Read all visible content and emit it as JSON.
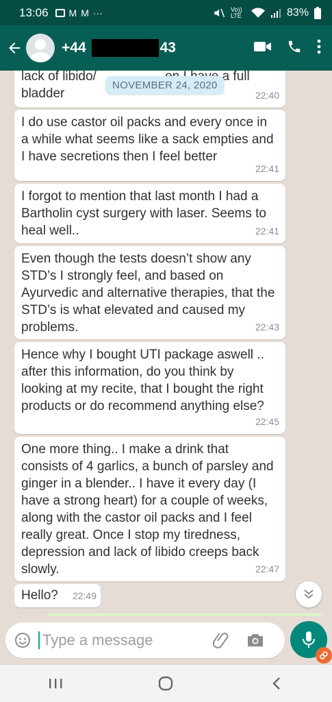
{
  "status_bar": {
    "time": "13:06",
    "network_label": "Vo)) LTE",
    "battery": "83%"
  },
  "header": {
    "contact_prefix": "+44",
    "contact_suffix": "43"
  },
  "chat": {
    "date_chip": "NOVEMBER 24, 2020",
    "messages": [
      {
        "text": "lack of libido/                   en I have a full bladder",
        "time": "22:40"
      },
      {
        "text": "I do use castor oil packs and every once in a while what seems like a sack empties and I have secretions then I feel better",
        "time": "22:41"
      },
      {
        "text": "I forgot to mention that last month I had a Bartholin cyst surgery with laser. Seems to heal well..",
        "time": "22:41"
      },
      {
        "text": "Even though the tests doesn’t show any STD’s I strongly feel, and based on Ayurvedic and alternative therapies, that the STD’s is what elevated and caused my problems.",
        "time": "22:43"
      },
      {
        "text": "Hence why I bought UTI package aswell .. after this information, do you think by looking at my recite, that I bought the right products or do recommend anything else?",
        "time": "22:45"
      },
      {
        "text": "One more thing.. I make a drink that consists of 4 garlics, a bunch of parsley and ginger in a blender.. I have it every day (I have a strong heart) for a couple of weeks, along with the castor oil packs and I feel really great. Once I stop my tiredness, depression and lack of libido creeps back slowly.",
        "time": "22:47"
      },
      {
        "text": "Hello?",
        "time": "22:49"
      }
    ]
  },
  "composer": {
    "placeholder": "Type a message"
  },
  "colors": {
    "header": "#075e54",
    "status_bar": "#054d44",
    "chat_bg": "#e5ddd5",
    "bubble": "#ffffff",
    "date_chip": "#d5edf6",
    "mic": "#00897b",
    "badge": "#ee6a30"
  },
  "icons": {
    "back": "arrow-left-icon",
    "video": "video-camera-icon",
    "call": "phone-icon",
    "menu": "more-vertical-icon",
    "emoji": "emoji-icon",
    "attach": "paperclip-icon",
    "camera": "camera-icon",
    "mic": "microphone-icon",
    "scroll": "double-chevron-down-icon"
  }
}
